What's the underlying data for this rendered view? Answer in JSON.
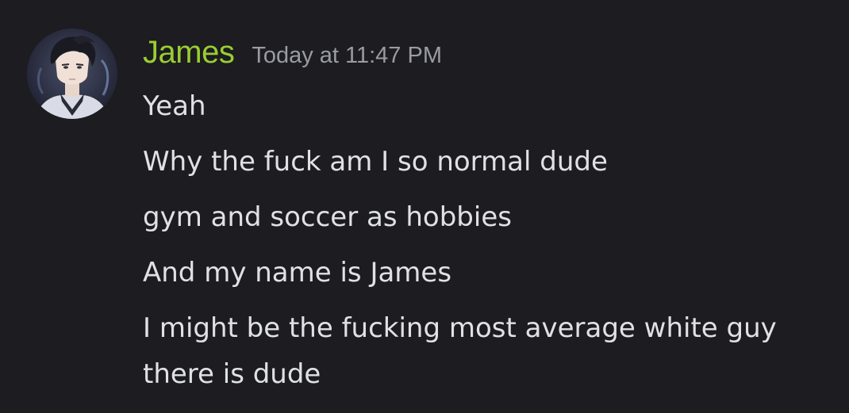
{
  "message": {
    "author": {
      "name": "James",
      "name_color": "#9acd32",
      "avatar": "avatar-image"
    },
    "timestamp": "Today at 11:47 PM",
    "lines": [
      "Yeah",
      "Why the fuck am I so normal dude",
      "gym and soccer as hobbies",
      "And my name is James",
      "I might be the fucking most average white guy there is dude"
    ]
  },
  "colors": {
    "background": "#1c1c21",
    "text": "#e0e1e5",
    "timestamp": "#9a9ba3"
  }
}
